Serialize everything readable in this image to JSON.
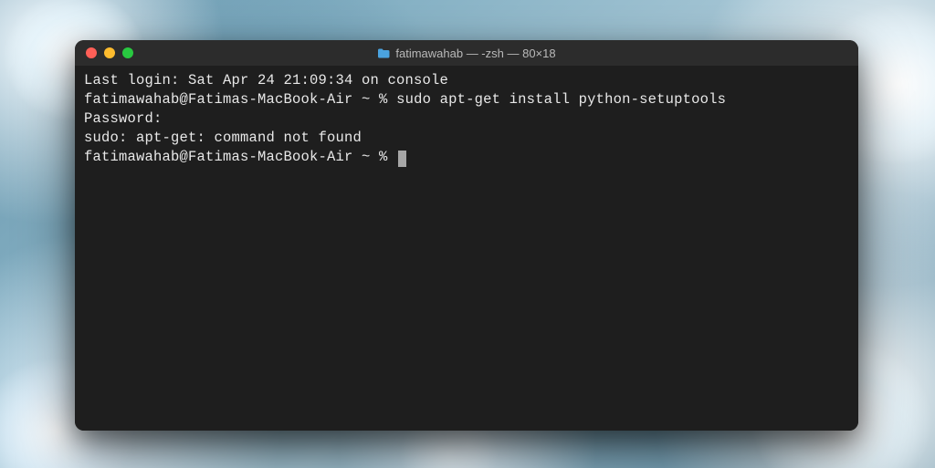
{
  "window": {
    "title": "fatimawahab — -zsh — 80×18"
  },
  "terminal": {
    "lines": {
      "0": "Last login: Sat Apr 24 21:09:34 on console",
      "1_prompt": "fatimawahab@Fatimas-MacBook-Air ~ % ",
      "1_cmd": "sudo apt-get install python-setuptools",
      "2": "Password:",
      "3": "sudo: apt-get: command not found",
      "4_prompt": "fatimawahab@Fatimas-MacBook-Air ~ % "
    }
  },
  "colors": {
    "terminal_bg": "#1e1e1e",
    "titlebar_bg": "#2c2c2c",
    "text": "#e8e8e8",
    "close": "#ff5f57",
    "minimize": "#febc2e",
    "maximize": "#28c840"
  }
}
